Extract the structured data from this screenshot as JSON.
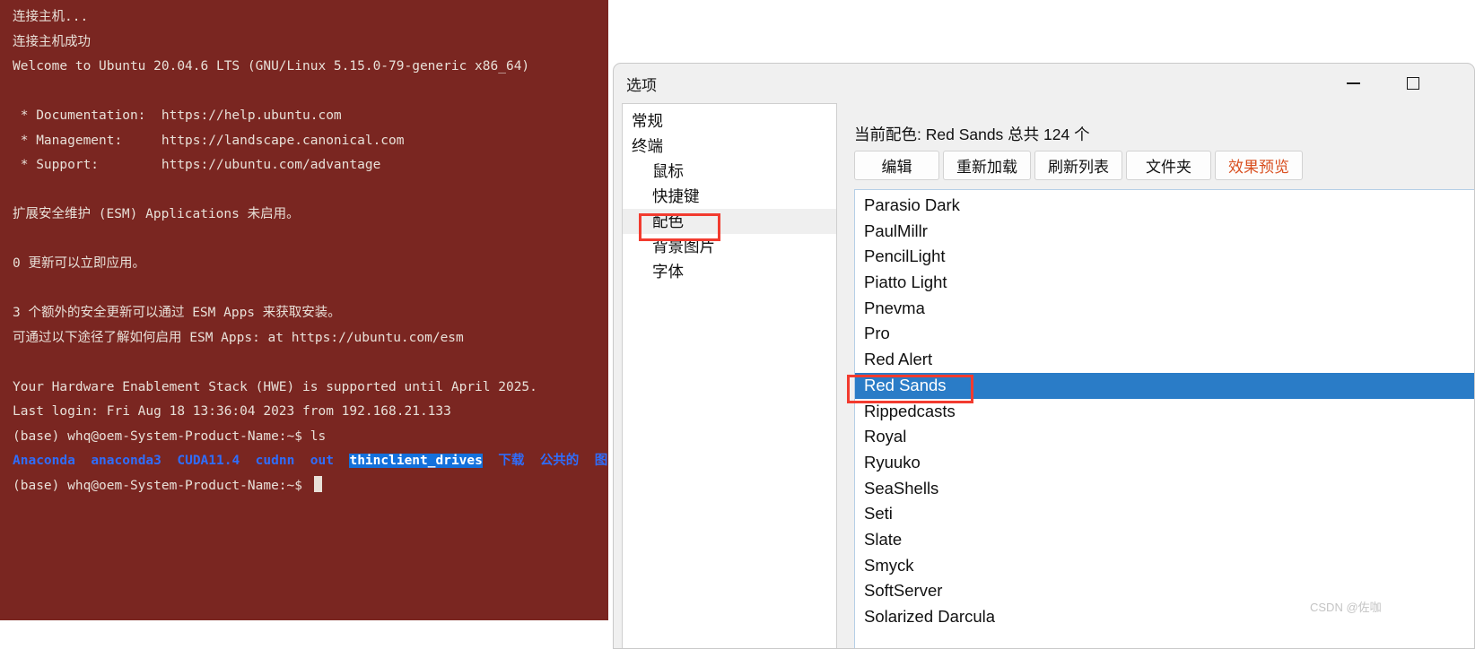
{
  "terminal": {
    "lines": [
      {
        "type": "plain",
        "text": "连接主机..."
      },
      {
        "type": "plain",
        "text": "连接主机成功"
      },
      {
        "type": "plain",
        "text": "Welcome to Ubuntu 20.04.6 LTS (GNU/Linux 5.15.0-79-generic x86_64)"
      },
      {
        "type": "blank",
        "text": ""
      },
      {
        "type": "plain",
        "text": " * Documentation:  https://help.ubuntu.com"
      },
      {
        "type": "plain",
        "text": " * Management:     https://landscape.canonical.com"
      },
      {
        "type": "plain",
        "text": " * Support:        https://ubuntu.com/advantage"
      },
      {
        "type": "blank",
        "text": ""
      },
      {
        "type": "plain",
        "text": "扩展安全维护 (ESM) Applications 未启用。"
      },
      {
        "type": "blank",
        "text": ""
      },
      {
        "type": "plain",
        "text": "0 更新可以立即应用。"
      },
      {
        "type": "blank",
        "text": ""
      },
      {
        "type": "plain",
        "text": "3 个额外的安全更新可以通过 ESM Apps 来获取安装。"
      },
      {
        "type": "plain",
        "text": "可通过以下途径了解如何启用 ESM Apps: at https://ubuntu.com/esm"
      },
      {
        "type": "blank",
        "text": ""
      },
      {
        "type": "plain",
        "text": "Your Hardware Enablement Stack (HWE) is supported until April 2025."
      },
      {
        "type": "plain",
        "text": "Last login: Fri Aug 18 13:36:04 2023 from 192.168.21.133"
      },
      {
        "type": "prompt",
        "text": "(base) whq@oem-System-Product-Name:~$ ls"
      },
      {
        "type": "ls",
        "text": ""
      },
      {
        "type": "prompt-cursor",
        "text": "(base) whq@oem-System-Product-Name:~$ "
      }
    ],
    "ls_entries": [
      {
        "name": "Anaconda",
        "style": "dir"
      },
      {
        "name": "anaconda3",
        "style": "dir"
      },
      {
        "name": "CUDA11.4",
        "style": "dir"
      },
      {
        "name": "cudnn",
        "style": "dir"
      },
      {
        "name": "out",
        "style": "dir"
      },
      {
        "name": "thinclient_drives",
        "style": "dir-selected"
      },
      {
        "name": "下载",
        "style": "dir"
      },
      {
        "name": "公共的",
        "style": "dir"
      },
      {
        "name": "图",
        "style": "dir"
      }
    ],
    "colors": {
      "background": "#7a2621",
      "foreground": "#e8e0d8",
      "dir": "#2f6dfb",
      "selection_bg": "#1471dc"
    }
  },
  "dialog": {
    "title": "选项",
    "window_buttons": {
      "minimize_icon": "minimize-icon",
      "maximize_icon": "maximize-icon"
    },
    "sidebar": {
      "items": [
        {
          "label": "常规",
          "indent": false,
          "selected": false
        },
        {
          "label": "终端",
          "indent": false,
          "selected": false
        },
        {
          "label": "鼠标",
          "indent": true,
          "selected": false
        },
        {
          "label": "快捷键",
          "indent": true,
          "selected": false
        },
        {
          "label": "配色",
          "indent": true,
          "selected": true
        },
        {
          "label": "背景图片",
          "indent": true,
          "selected": false
        },
        {
          "label": "字体",
          "indent": true,
          "selected": false
        }
      ]
    },
    "panel": {
      "current_scheme_text": "当前配色: Red Sands 总共 124 个",
      "current_scheme_name": "Red Sands",
      "total_count": "124",
      "buttons": [
        {
          "label": "编辑",
          "accent": false
        },
        {
          "label": "重新加载",
          "accent": false
        },
        {
          "label": "刷新列表",
          "accent": false
        },
        {
          "label": "文件夹",
          "accent": false
        },
        {
          "label": "效果预览",
          "accent": true
        }
      ],
      "accent_color": "#d94f20",
      "selection_color": "#2a7cc7",
      "annotation_color": "#f23b2f",
      "scheme_list": [
        {
          "name": "Parasio Dark",
          "selected": false
        },
        {
          "name": "PaulMillr",
          "selected": false
        },
        {
          "name": "PencilLight",
          "selected": false
        },
        {
          "name": "Piatto Light",
          "selected": false
        },
        {
          "name": "Pnevma",
          "selected": false
        },
        {
          "name": "Pro",
          "selected": false
        },
        {
          "name": "Red Alert",
          "selected": false
        },
        {
          "name": "Red Sands",
          "selected": true
        },
        {
          "name": "Rippedcasts",
          "selected": false
        },
        {
          "name": "Royal",
          "selected": false
        },
        {
          "name": "Ryuuko",
          "selected": false
        },
        {
          "name": "SeaShells",
          "selected": false
        },
        {
          "name": "Seti",
          "selected": false
        },
        {
          "name": "Slate",
          "selected": false
        },
        {
          "name": "Smyck",
          "selected": false
        },
        {
          "name": "SoftServer",
          "selected": false
        },
        {
          "name": "Solarized Darcula",
          "selected": false
        }
      ]
    }
  },
  "watermark": {
    "text": "CSDN @佐咖"
  }
}
